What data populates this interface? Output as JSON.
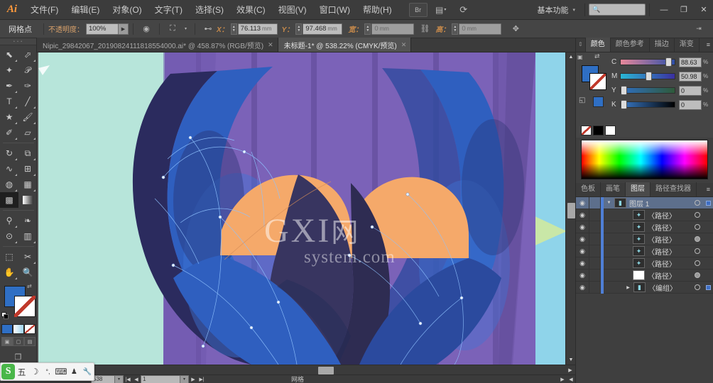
{
  "app": {
    "logo": "Ai",
    "workspace": "基本功能",
    "workspace_caret": "▾"
  },
  "menubar": {
    "items": [
      {
        "label": "文件(F)"
      },
      {
        "label": "编辑(E)"
      },
      {
        "label": "对象(O)"
      },
      {
        "label": "文字(T)"
      },
      {
        "label": "选择(S)"
      },
      {
        "label": "效果(C)"
      },
      {
        "label": "视图(V)"
      },
      {
        "label": "窗口(W)"
      },
      {
        "label": "帮助(H)"
      }
    ],
    "bridge_icon": "Br",
    "arrange_icon": "▤",
    "arrange_caret": "▾",
    "stock_icon": "⟳",
    "search_placeholder": "",
    "window_controls": {
      "minimize": "—",
      "restore": "❐",
      "close": "✕"
    }
  },
  "optionsbar": {
    "selection_title": "网格点",
    "opacity_label": "不透明度：",
    "opacity_value": "100%",
    "opacity_caret": "▶",
    "recolor_icon": "◉",
    "transform_icon": "⛶",
    "transform_caret": "▾",
    "align_icon": "⊷",
    "x_label": "X：",
    "x_value": "76.113",
    "x_unit": "mm",
    "y_label": "Y：",
    "y_value": "97.468",
    "y_unit": "mm",
    "w_label": "宽：",
    "w_value": "0",
    "w_unit": "mm",
    "link_icon": "⛓",
    "h_label": "高：",
    "h_value": "0",
    "h_unit": "mm",
    "anchor_icon": "✥",
    "panel_menu": "⇥"
  },
  "toolbox": {
    "grip": "• • • •",
    "tools": [
      {
        "name": "selection-tool",
        "glyph": "⬉",
        "sub": true
      },
      {
        "name": "direct-selection-tool",
        "glyph": "⬀",
        "sub": true
      },
      {
        "name": "magic-wand-tool",
        "glyph": "✦",
        "sub": false
      },
      {
        "name": "lasso-tool",
        "glyph": "𝒫",
        "sub": false
      },
      {
        "name": "pen-tool",
        "glyph": "✒",
        "sub": true
      },
      {
        "name": "curvature-tool",
        "glyph": "✑",
        "sub": false
      },
      {
        "name": "type-tool",
        "glyph": "T",
        "sub": true
      },
      {
        "name": "line-segment-tool",
        "glyph": "╱",
        "sub": true
      },
      {
        "name": "shape-tool",
        "glyph": "★",
        "sub": true
      },
      {
        "name": "paintbrush-tool",
        "glyph": "🖌",
        "sub": true
      },
      {
        "name": "pencil-tool",
        "glyph": "✐",
        "sub": true
      },
      {
        "name": "eraser-tool",
        "glyph": "▱",
        "sub": true
      },
      {
        "name": "rotate-tool",
        "glyph": "↻",
        "sub": true
      },
      {
        "name": "scale-tool",
        "glyph": "⧉",
        "sub": true
      },
      {
        "name": "width-tool",
        "glyph": "∿",
        "sub": true
      },
      {
        "name": "free-transform-tool",
        "glyph": "⊞",
        "sub": true
      },
      {
        "name": "shape-builder-tool",
        "glyph": "◍",
        "sub": true
      },
      {
        "name": "perspective-grid-tool",
        "glyph": "▦",
        "sub": true
      },
      {
        "name": "mesh-tool",
        "glyph": "▩",
        "sub": false
      },
      {
        "name": "gradient-tool",
        "glyph": "▤",
        "sub": false
      },
      {
        "name": "eyedropper-tool",
        "glyph": "⚲",
        "sub": true
      },
      {
        "name": "blend-tool",
        "glyph": "❧",
        "sub": false
      },
      {
        "name": "symbol-sprayer-tool",
        "glyph": "⊙",
        "sub": true
      },
      {
        "name": "column-graph-tool",
        "glyph": "▥",
        "sub": true
      },
      {
        "name": "artboard-tool",
        "glyph": "⬚",
        "sub": false
      },
      {
        "name": "slice-tool",
        "glyph": "✂",
        "sub": true
      },
      {
        "name": "hand-tool",
        "glyph": "✋",
        "sub": true
      },
      {
        "name": "zoom-tool",
        "glyph": "🔍",
        "sub": false
      }
    ],
    "fill_color": "#2f6fc4",
    "stroke_color": "#ffffff",
    "swap_icon": "⇄",
    "color_modes": [
      {
        "name": "color-mode-solid"
      },
      {
        "name": "color-mode-gradient"
      },
      {
        "name": "color-mode-none"
      }
    ],
    "draw_modes": [
      {
        "name": "draw-normal",
        "glyph": "▣"
      },
      {
        "name": "draw-behind",
        "glyph": "▢"
      },
      {
        "name": "draw-inside",
        "glyph": "▤"
      }
    ],
    "screen_mode_icon": "❐"
  },
  "tabs": [
    {
      "label": "Nipic_29842067_20190824111818554000.ai* @ 458.87% (RGB/预览)",
      "close": "✕",
      "active": false
    },
    {
      "label": "未标题-1* @ 538.22% (CMYK/预览)",
      "close": "✕",
      "active": true
    }
  ],
  "canvas": {
    "watermark_top": "GXI",
    "watermark_top_cn": "网",
    "watermark_bottom": "system.com",
    "colors": {
      "background_mint": "#b7e5da",
      "background_blue": "#8fd4ea",
      "shirt_purple": "#7b62b8",
      "shirt_stripe": "#6a53a4",
      "arm_blue": "#2f5fbf",
      "arm_dark": "#2b2b5e",
      "hand_orange": "#f5a96a",
      "accent_green": "#cfe9a0",
      "mesh_line": "#7fb4f5"
    }
  },
  "scrollbars": {
    "v_up": "▲",
    "v_down": "▼",
    "h_left": "◀",
    "h_right": "▶"
  },
  "statusbar": {
    "zoom_value": "538",
    "zoom_caret": "▾",
    "first_page": "|◀",
    "prev_page": "◀",
    "page_value": "1",
    "page_caret": "▾",
    "next_page": "▶",
    "last_page": "▶|",
    "status_text": "网格",
    "status_caret": "▶",
    "resize_caret": "◀"
  },
  "color_panel": {
    "tabs": [
      {
        "label": "颜色",
        "active": true
      },
      {
        "label": "颜色参考",
        "active": false
      },
      {
        "label": "描边",
        "active": false
      },
      {
        "label": "渐变",
        "active": false
      }
    ],
    "menu_icon": "≡",
    "mode": "CMYK",
    "channels": [
      {
        "label": "C",
        "value": "88.63",
        "pct": "%",
        "percent": 88.63,
        "from": "#e8889a",
        "to": "#2d4fa8"
      },
      {
        "label": "M",
        "value": "50.98",
        "pct": "%",
        "percent": 50.98,
        "from": "#2ab7d4",
        "to": "#3b2fa0"
      },
      {
        "label": "Y",
        "value": "0",
        "pct": "%",
        "percent": 0,
        "from": "#2f6fc4",
        "to": "#2f5a3a"
      },
      {
        "label": "K",
        "value": "0",
        "pct": "%",
        "percent": 0,
        "from": "#3a7ccc",
        "to": "#000000"
      }
    ],
    "quick_swatches": [
      {
        "name": "none-swatch"
      },
      {
        "name": "black-swatch"
      },
      {
        "name": "white-swatch"
      }
    ]
  },
  "layers_panel": {
    "tabs": [
      {
        "label": "色板",
        "active": false
      },
      {
        "label": "画笔",
        "active": false
      },
      {
        "label": "图层",
        "active": true
      },
      {
        "label": "路径查找器",
        "active": false
      }
    ],
    "menu_icon": "≡",
    "eye_icon": "◉",
    "rows": [
      {
        "name": "图层 1",
        "indent": 0,
        "type": "layer",
        "selected": true,
        "expanded": true,
        "thumb": "layer",
        "target_filled": false,
        "has_sel": true
      },
      {
        "name": "〈路径〉",
        "indent": 2,
        "type": "path",
        "selected": false,
        "expanded": false,
        "thumb": "art",
        "target_filled": false,
        "has_sel": false
      },
      {
        "name": "〈路径〉",
        "indent": 2,
        "type": "path",
        "selected": false,
        "expanded": false,
        "thumb": "art",
        "target_filled": false,
        "has_sel": false
      },
      {
        "name": "〈路径〉",
        "indent": 2,
        "type": "path",
        "selected": false,
        "expanded": false,
        "thumb": "art",
        "target_filled": true,
        "has_sel": false
      },
      {
        "name": "〈路径〉",
        "indent": 2,
        "type": "path",
        "selected": false,
        "expanded": false,
        "thumb": "art",
        "target_filled": false,
        "has_sel": false
      },
      {
        "name": "〈路径〉",
        "indent": 2,
        "type": "path",
        "selected": false,
        "expanded": false,
        "thumb": "art",
        "target_filled": false,
        "has_sel": false
      },
      {
        "name": "〈路径〉",
        "indent": 2,
        "type": "path",
        "selected": false,
        "expanded": false,
        "thumb": "blank",
        "target_filled": true,
        "has_sel": false
      },
      {
        "name": "〈编组〉",
        "indent": 1,
        "type": "group",
        "selected": false,
        "expanded": false,
        "thumb": "group",
        "target_filled": false,
        "has_sel": true
      }
    ]
  },
  "ime": {
    "logo": "S",
    "buttons": [
      {
        "name": "ime-mode-chinese",
        "glyph": "五"
      },
      {
        "name": "ime-moon",
        "glyph": "☽"
      },
      {
        "name": "ime-punctuation",
        "glyph": "°,"
      },
      {
        "name": "ime-keyboard",
        "glyph": "⌨"
      },
      {
        "name": "ime-user",
        "glyph": "♟"
      },
      {
        "name": "ime-settings",
        "glyph": "🔧"
      }
    ]
  }
}
